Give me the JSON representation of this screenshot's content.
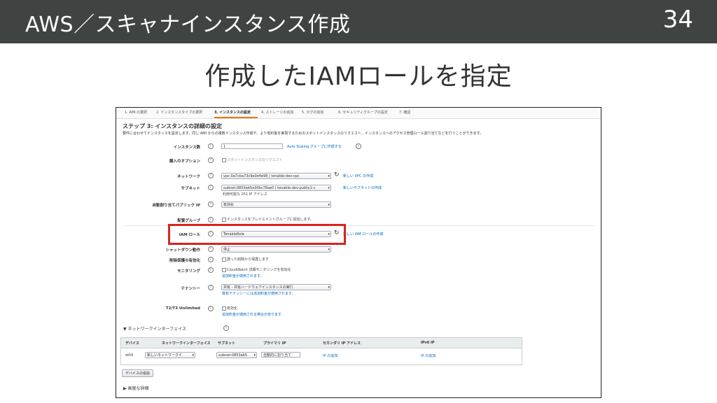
{
  "slide": {
    "title": "AWS／スキャナインスタンス作成",
    "number": "34",
    "subtitle": "作成したIAMロールを指定"
  },
  "wizard": {
    "steps": [
      "1. AMI の選択",
      "2. インスタンスタイプの選択",
      "3. インスタンスの設定",
      "4. ストレージの追加",
      "5. タグの追加",
      "6. セキュリティグループの設定",
      "7. 確認"
    ],
    "active_step": 2,
    "heading": "ステップ 3: インスタンスの詳細の設定",
    "description": "要件に合わせてインスタンスを設定します。同じ AMI からの複数インスタンス作成や、より低料金を実現するためのスポットインスタンスのリクエスト、インスタンスへのアクセス管理ロール割り当てなどを行うことができます。"
  },
  "form": {
    "instance_count": {
      "label": "インスタンス数",
      "value": "1",
      "link": "Auto Scaling グループに作成する"
    },
    "purchase_option": {
      "label": "購入のオプション",
      "checkbox": "スポットインスタンスのリクエスト"
    },
    "network": {
      "label": "ネットワーク",
      "value": "vpc-0a7cba73c9e0e4e98 | tenable-dev-vpc",
      "link": "新しい VPC の作成"
    },
    "subnet": {
      "label": "サブネット",
      "value": "subnet-0853ab5a30bc78ae0 | tenable-dev-public1-c",
      "note": "利用可能な 251 IP アドレス",
      "link": "新しいサブネットの作成"
    },
    "auto_public_ip": {
      "label": "自動割り当てパブリック IP",
      "value": "有効化"
    },
    "placement_group": {
      "label": "配置グループ",
      "checkbox": "インスタンスをプレイスメントグループに追加します。"
    },
    "iam_role": {
      "label": "IAM ロール",
      "value": "TenableRole",
      "link": "新しい IAM ロールの作成"
    },
    "shutdown": {
      "label": "シャットダウン動作",
      "value": "停止"
    },
    "termination_protection": {
      "label": "削除保護の有効化",
      "checkbox": "誤った削除から保護します"
    },
    "monitoring": {
      "label": "モニタリング",
      "checkbox": "CloudWatch 詳細モニタリングを有効化",
      "note": "追加料金が適用されます。"
    },
    "tenancy": {
      "label": "テナンシー",
      "value": "共有 - 共有ハードウェアインスタンスの実行",
      "note": "専有テナンシーには追加料金が適用されます。"
    },
    "t2t3": {
      "label": "T2/T3 Unlimited",
      "checkbox": "有効化",
      "note": "追加料金が適用される場合があります"
    }
  },
  "network_interfaces": {
    "heading": "ネットワークインターフェイス",
    "columns": [
      "デバイス",
      "ネットワークインターフェイス",
      "サブネット",
      "プライマリ IP",
      "セカンダリ IP アドレス",
      "IPv6 IP"
    ],
    "row": {
      "device": "eth0",
      "interface": "新しいネットワークイ",
      "subnet": "subnet-0853ab5",
      "primary_ip": "自動的に割り当て",
      "secondary_ip": "IP の追加",
      "ipv6": "IP の追加"
    },
    "add_device_button": "デバイスの追加"
  },
  "advanced": {
    "heading": "高度な詳細"
  },
  "colors": {
    "highlight": "#d9241c",
    "link": "#0066c0",
    "topbar": "#3f4443",
    "active_tab": "#e47911"
  }
}
